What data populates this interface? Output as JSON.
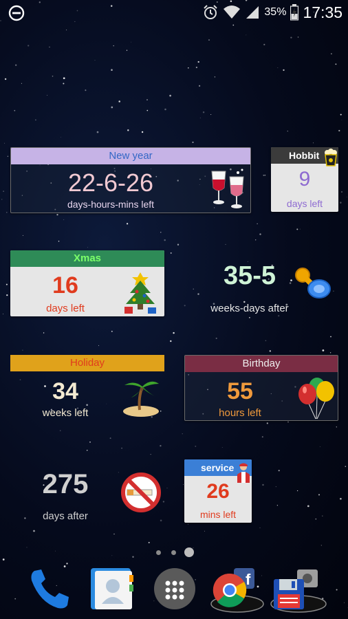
{
  "status_bar": {
    "battery_percent": "35%",
    "time": "17:35",
    "icons": [
      "minus-circle-icon",
      "alarm-icon",
      "wifi-icon",
      "signal-icon",
      "battery-icon"
    ]
  },
  "widgets": {
    "new_year": {
      "title": "New year",
      "value": "22-6-26",
      "subtitle": "days-hours-mins left",
      "icon": "wine-glasses-icon",
      "header_color": "#c6b3e6"
    },
    "hobbit": {
      "title": "Hobbit",
      "value": "9",
      "subtitle": "days left",
      "icon": "popcorn-icon",
      "header_color": "#3b3b3b"
    },
    "xmas": {
      "title": "Xmas",
      "value": "16",
      "subtitle": "days left",
      "icon": "christmas-tree-icon",
      "header_color": "#2e8b57"
    },
    "baby": {
      "value": "35-5",
      "subtitle": "weeks-days after",
      "icon": "pacifier-icon"
    },
    "holiday": {
      "title": "Holiday",
      "value": "34",
      "subtitle": "weeks left",
      "icon": "palm-island-icon",
      "header_color": "#e0a21b"
    },
    "birthday": {
      "title": "Birthday",
      "value": "55",
      "subtitle": "hours left",
      "icon": "balloons-icon",
      "header_color": "#7a2d44"
    },
    "smoking": {
      "value": "275",
      "subtitle": "days after",
      "icon": "no-smoking-icon"
    },
    "service": {
      "title": "service",
      "value": "26",
      "subtitle": "mins left",
      "icon": "mechanic-icon",
      "header_color": "#3b7fd6"
    }
  },
  "page_indicator": {
    "pages": 3,
    "current": 3
  },
  "dock": [
    {
      "name": "phone",
      "icon": "phone-icon"
    },
    {
      "name": "contacts",
      "icon": "contacts-icon"
    },
    {
      "name": "app-drawer",
      "icon": "apps-grid-icon"
    },
    {
      "name": "chrome-folder",
      "icon": "chrome-icon"
    },
    {
      "name": "save-folder",
      "icon": "floppy-disk-icon"
    }
  ]
}
